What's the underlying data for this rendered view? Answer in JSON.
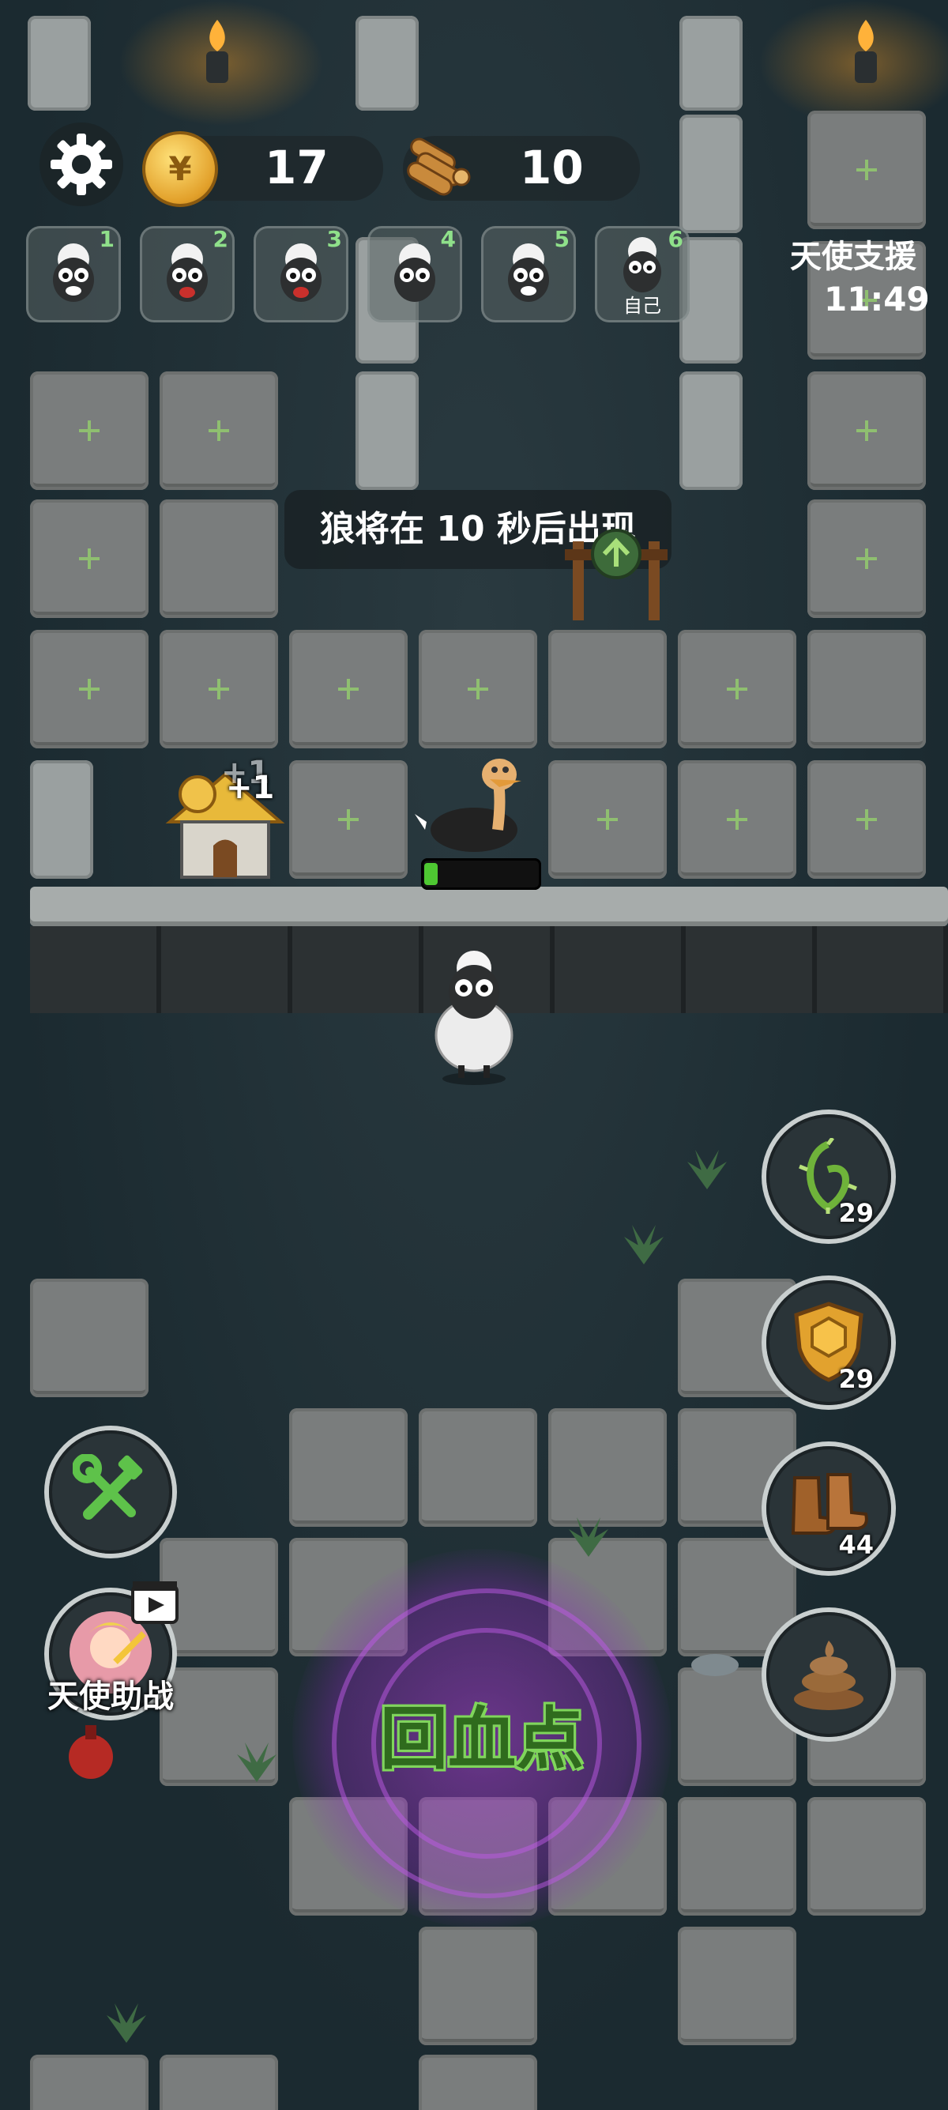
{
  "hud": {
    "coins": "17",
    "coin_icon": "coin-icon",
    "wood": "10",
    "wood_icon": "wood-logs-icon",
    "settings_icon": "gear-icon"
  },
  "players": [
    {
      "num": "1",
      "tag": ""
    },
    {
      "num": "2",
      "tag": ""
    },
    {
      "num": "3",
      "tag": ""
    },
    {
      "num": "4",
      "tag": ""
    },
    {
      "num": "5",
      "tag": ""
    },
    {
      "num": "6",
      "tag": "自己"
    }
  ],
  "angel_support": {
    "title": "天使支援",
    "time": "11:49"
  },
  "banner": {
    "text": "狼将在 10 秒后出现"
  },
  "house": {
    "plus_back": "+1",
    "plus_front": "+1"
  },
  "ostrich": {
    "hp_fraction": 0.12
  },
  "items": [
    {
      "icon": "thorn-vine-icon",
      "count": "29"
    },
    {
      "icon": "shield-icon",
      "count": "29"
    },
    {
      "icon": "boots-icon",
      "count": "44"
    },
    {
      "icon": "poop-icon",
      "count": ""
    }
  ],
  "left_buttons": {
    "build_icon": "wrench-hammer-icon",
    "assist_label": "天使助战",
    "video_icon": "video-ad-icon"
  },
  "heal_zone": {
    "label": "回血点"
  },
  "colors": {
    "hp": "#4ec832",
    "heal_purple": "#a63cd2",
    "slot_number": "#8fe08a"
  }
}
